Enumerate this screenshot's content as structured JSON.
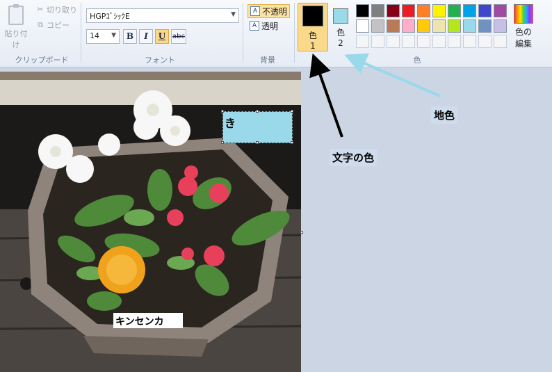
{
  "ribbon": {
    "clipboard": {
      "paste_label": "貼り付け",
      "cut_label": "切り取り",
      "copy_label": "コピー",
      "group_label": "クリップボード"
    },
    "font": {
      "family_value": "HGPｺﾞｼｯｸE",
      "size_value": "14",
      "bold_label": "B",
      "italic_label": "I",
      "underline_label": "U",
      "strike_label": "abc",
      "group_label": "フォント"
    },
    "background": {
      "opaque_label": "不透明",
      "transparent_label": "透明",
      "group_label": "背景"
    },
    "colors": {
      "color1_label": "色",
      "color1_num": "1",
      "color1_value": "#000000",
      "color2_label": "色",
      "color2_num": "2",
      "color2_value": "#99d9ea",
      "edit_label": "色の",
      "edit_label2": "編集",
      "group_label": "色",
      "palette": [
        "#000000",
        "#7f7f7f",
        "#880015",
        "#ed1c24",
        "#ff7f27",
        "#fff200",
        "#22b14c",
        "#00a2e8",
        "#3f48cc",
        "#a349a4",
        "#ffffff",
        "#c3c3c3",
        "#b97a57",
        "#ffaec9",
        "#ffc90e",
        "#efe4b0",
        "#b5e61d",
        "#99d9ea",
        "#7092be",
        "#c8bfe7",
        "",
        "",
        "",
        "",
        "",
        "",
        "",
        "",
        "",
        ""
      ]
    }
  },
  "canvas": {
    "text_box_value": "き",
    "caption_text": "キンセンカ"
  },
  "annotations": {
    "text_color_label": "文字の色",
    "background_color_label": "地色"
  }
}
